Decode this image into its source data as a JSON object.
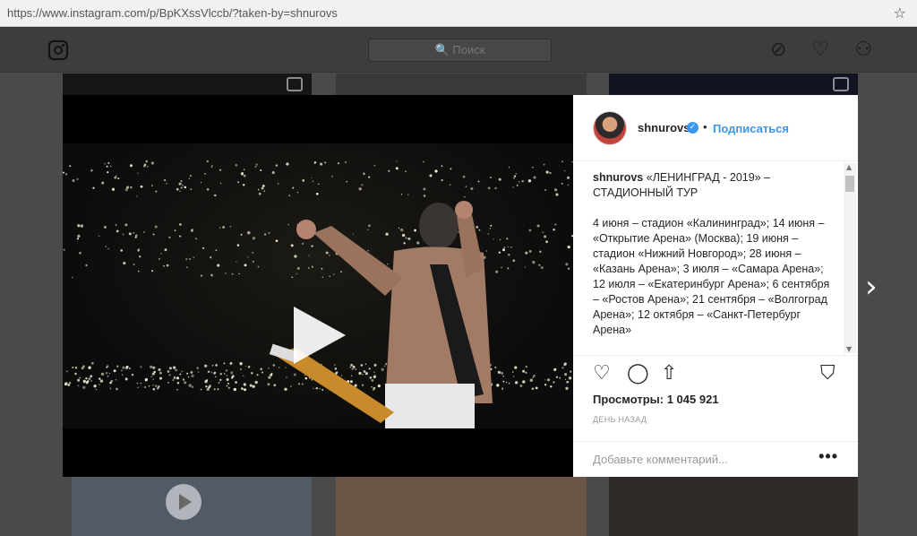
{
  "browser": {
    "url": "https://www.instagram.com/p/BpKXssVlccb/?taken-by=shnurovs",
    "star_icon": "☆"
  },
  "nav": {
    "search_placeholder": "🔍 Поиск",
    "icons": [
      "compass-icon",
      "heart-icon",
      "profile-icon"
    ]
  },
  "post": {
    "username": "shnurovs",
    "verified_mark": "✓",
    "separator": "•",
    "follow_label": "Подписаться",
    "caption_user": "shnurovs",
    "caption_title": "«ЛЕНИНГРАД - 2019» – СТАДИОННЫЙ ТУР",
    "caption_body": "4 июня – стадион «Калининград»; 14 июня – «Открытие Арена» (Москва); 19 июня – стадион «Нижний Новгород»; 28 июня – «Казань Арена»; 3 июля – «Самара Арена»; 12 июля – «Екатеринбург Арена»; 6 сентября – «Ростов Арена»; 21 сентября – «Волгоград Арена»; 12 октября – «Санкт-Петербург Арена»",
    "views_label": "Просмотры:",
    "views_count": "1 045 921",
    "time_ago": "ДЕНЬ НАЗАД",
    "comment_placeholder": "Добавьте комментарий...",
    "more_label": "•••"
  },
  "colors": {
    "accent": "#3897f0",
    "text": "#262626",
    "muted": "#999999"
  }
}
